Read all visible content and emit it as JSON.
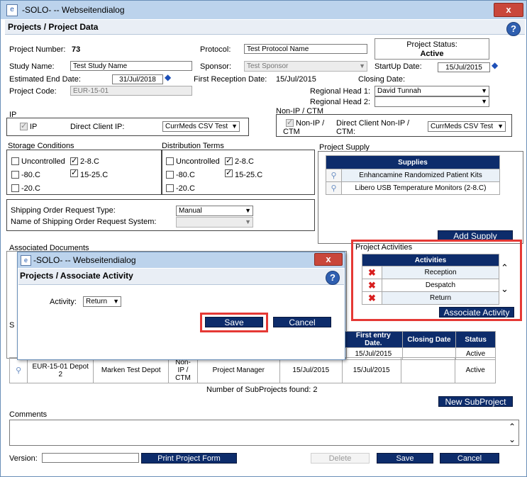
{
  "window": {
    "title": "-SOLO- -- Webseitendialog",
    "close": "x"
  },
  "page": {
    "title": "Projects / Project Data",
    "help": "?"
  },
  "project": {
    "number_label": "Project Number:",
    "number": "73",
    "protocol_label": "Protocol:",
    "protocol": "Test Protocol Name",
    "status_label": "Project Status:",
    "status": "Active",
    "study_label": "Study Name:",
    "study": "Test Study Name",
    "sponsor_label": "Sponsor:",
    "sponsor": "Test Sponsor",
    "startup_label": "StartUp Date:",
    "startup": "15/Jul/2015",
    "end_label": "Estimated End Date:",
    "end": "31/Jul/2018",
    "first_reception_label": "First Reception Date:",
    "first_reception": "15/Jul/2015",
    "closing_label": "Closing Date:",
    "code_label": "Project Code:",
    "code": "EUR-15-01",
    "regional1_label": "Regional Head 1:",
    "regional1": "David Tunnah",
    "regional2_label": "Regional Head 2:",
    "regional2": ""
  },
  "ip": {
    "section": "IP",
    "checkbox": "IP",
    "client_label": "Direct Client IP:",
    "client": "CurrMeds CSV Test"
  },
  "nonip": {
    "section": "Non-IP / CTM",
    "checkbox": "Non-IP / CTM",
    "client_label": "Direct Client Non-IP / CTM:",
    "client": "CurrMeds CSV Test"
  },
  "storage": {
    "title": "Storage Conditions",
    "items": [
      "Uncontrolled",
      "2-8.C",
      "-80.C",
      "15-25.C",
      "-20.C"
    ]
  },
  "distribution": {
    "title": "Distribution Terms",
    "items": [
      "Uncontrolled",
      "2-8.C",
      "-80.C",
      "15-25.C",
      "-20.C"
    ]
  },
  "shipping": {
    "type_label": "Shipping Order Request Type:",
    "type": "Manual",
    "system_label": "Name of Shipping Order Request System:",
    "system": ""
  },
  "supply": {
    "title": "Project Supply",
    "header": "Supplies",
    "rows": [
      "Enhancamine Randomized Patient Kits",
      "Libero USB Temperature Monitors (2-8.C)"
    ],
    "add": "Add Supply"
  },
  "activities": {
    "title": "Project Activities",
    "header": "Activities",
    "rows": [
      "Reception",
      "Despatch",
      "Return"
    ],
    "associate": "Associate Activity"
  },
  "assoc_docs": {
    "title": "Associated Documents"
  },
  "subprojects": {
    "headers": [
      "First entry Date.",
      "Closing Date",
      "Status"
    ],
    "row1": {
      "first_entry": "15/Jul/2015",
      "closing": "",
      "status": "Active"
    },
    "row2": {
      "code": "EUR-15-01 Depot 2",
      "depot": "Marken Test Depot",
      "type": "Non-IP / CTM",
      "role": "Project Manager",
      "date": "15/Jul/2015",
      "first_entry": "15/Jul/2015",
      "closing": "",
      "status": "Active"
    },
    "found": "Number of SubProjects found: 2",
    "new": "New SubProject"
  },
  "comments": {
    "label": "Comments",
    "value": ""
  },
  "footer": {
    "version_label": "Version:",
    "version": "",
    "print": "Print Project Form",
    "delete": "Delete",
    "save": "Save",
    "cancel": "Cancel"
  },
  "dialog": {
    "window_title": "-SOLO- -- Webseitendialog",
    "title": "Projects / Associate Activity",
    "activity_label": "Activity:",
    "activity": "Return",
    "save": "Save",
    "cancel": "Cancel"
  },
  "colors": {
    "button_navy": "#0d2c6b",
    "titlebar": "#bcd3ec",
    "close_red": "#c9473b",
    "highlight_red": "#e53935"
  }
}
